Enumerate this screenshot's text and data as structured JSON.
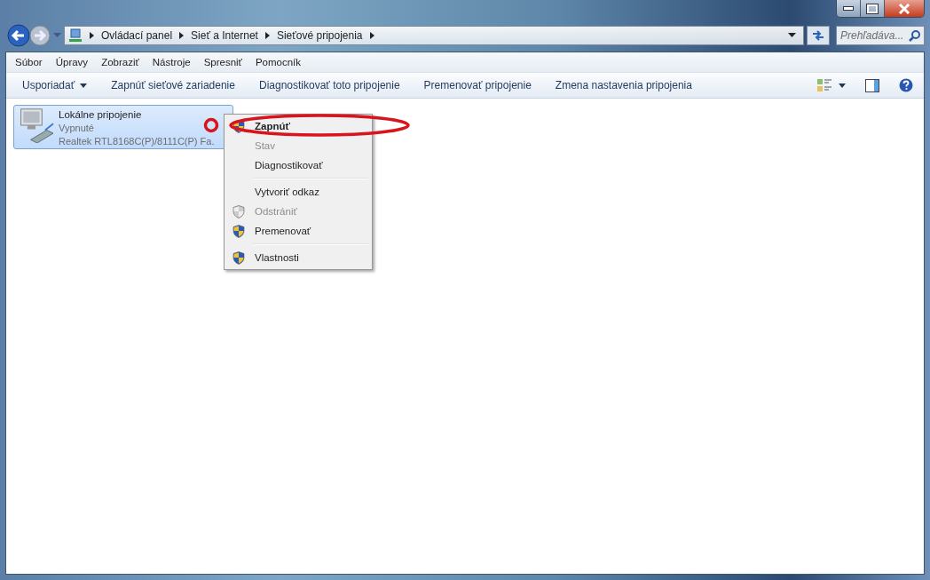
{
  "breadcrumb": [
    "Ovládací panel",
    "Sieť a Internet",
    "Sieťové pripojenia"
  ],
  "search": {
    "placeholder": "Prehľadáva..."
  },
  "menu_bar": [
    "Súbor",
    "Úpravy",
    "Zobraziť",
    "Nástroje",
    "Spresniť",
    "Pomocník"
  ],
  "command_bar": [
    {
      "label": "Usporiadať",
      "dropdown": true
    },
    {
      "label": "Zapnúť sieťové zariadenie",
      "dropdown": false
    },
    {
      "label": "Diagnostikovať toto pripojenie",
      "dropdown": false
    },
    {
      "label": "Premenovať pripojenie",
      "dropdown": false
    },
    {
      "label": "Zmena nastavenia pripojenia",
      "dropdown": false
    }
  ],
  "connection": {
    "name": "Lokálne pripojenie",
    "status": "Vypnuté",
    "adapter": "Realtek RTL8168C(P)/8111C(P) Fa.",
    "selected": true
  },
  "context_menu": [
    [
      {
        "label": "Zapnúť",
        "default": true,
        "disabled": false,
        "shield": true
      },
      {
        "label": "Stav",
        "default": false,
        "disabled": true,
        "shield": false
      },
      {
        "label": "Diagnostikovať",
        "default": false,
        "disabled": false,
        "shield": false
      }
    ],
    [
      {
        "label": "Vytvoriť odkaz",
        "default": false,
        "disabled": false,
        "shield": false
      },
      {
        "label": "Odstrániť",
        "default": false,
        "disabled": true,
        "shield": true
      },
      {
        "label": "Premenovať",
        "default": false,
        "disabled": false,
        "shield": true
      }
    ],
    [
      {
        "label": "Vlastnosti",
        "default": false,
        "disabled": false,
        "shield": true
      }
    ]
  ]
}
